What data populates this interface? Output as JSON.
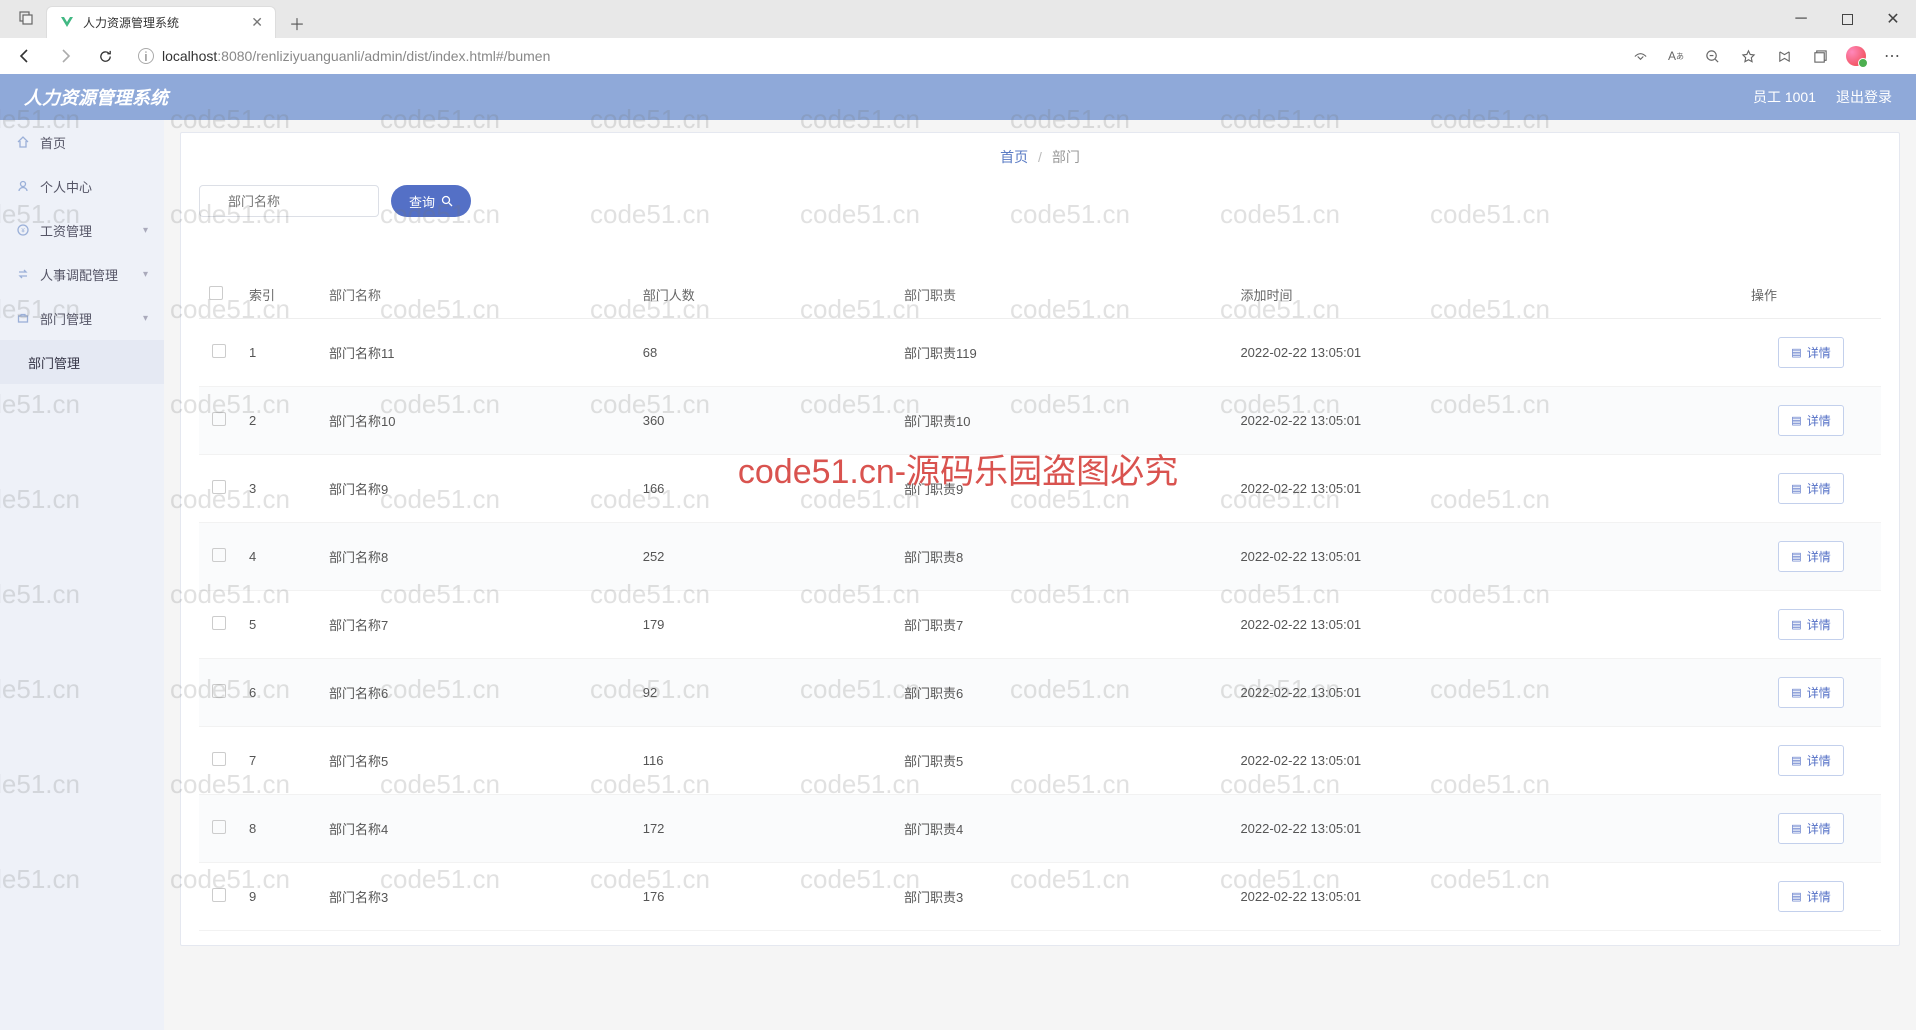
{
  "browser": {
    "tab_title": "人力资源管理系统",
    "url_host": "localhost",
    "url_port": ":8080",
    "url_path": "/renliziyuanguanli/admin/dist/index.html#/bumen"
  },
  "header": {
    "app_title": "人力资源管理系统",
    "user_label": "员工 1001",
    "logout_label": "退出登录"
  },
  "sidebar": {
    "items": [
      {
        "label": "首页",
        "icon": "home"
      },
      {
        "label": "个人中心",
        "icon": "user"
      },
      {
        "label": "工资管理",
        "icon": "money",
        "expandable": true
      },
      {
        "label": "人事调配管理",
        "icon": "swap",
        "expandable": true
      },
      {
        "label": "部门管理",
        "icon": "briefcase",
        "expandable": true
      }
    ],
    "active_sub": "部门管理"
  },
  "breadcrumb": {
    "home": "首页",
    "current": "部门"
  },
  "search": {
    "placeholder": "部门名称",
    "button": "查询"
  },
  "table": {
    "headers": {
      "index": "索引",
      "name": "部门名称",
      "count": "部门人数",
      "duty": "部门职责",
      "time": "添加时间",
      "op": "操作"
    },
    "detail_label": "详情",
    "rows": [
      {
        "index": "1",
        "name": "部门名称11",
        "count": "68",
        "duty": "部门职责119",
        "time": "2022-02-22 13:05:01"
      },
      {
        "index": "2",
        "name": "部门名称10",
        "count": "360",
        "duty": "部门职责10",
        "time": "2022-02-22 13:05:01"
      },
      {
        "index": "3",
        "name": "部门名称9",
        "count": "166",
        "duty": "部门职责9",
        "time": "2022-02-22 13:05:01"
      },
      {
        "index": "4",
        "name": "部门名称8",
        "count": "252",
        "duty": "部门职责8",
        "time": "2022-02-22 13:05:01"
      },
      {
        "index": "5",
        "name": "部门名称7",
        "count": "179",
        "duty": "部门职责7",
        "time": "2022-02-22 13:05:01"
      },
      {
        "index": "6",
        "name": "部门名称6",
        "count": "92",
        "duty": "部门职责6",
        "time": "2022-02-22 13:05:01"
      },
      {
        "index": "7",
        "name": "部门名称5",
        "count": "116",
        "duty": "部门职责5",
        "time": "2022-02-22 13:05:01"
      },
      {
        "index": "8",
        "name": "部门名称4",
        "count": "172",
        "duty": "部门职责4",
        "time": "2022-02-22 13:05:01"
      },
      {
        "index": "9",
        "name": "部门名称3",
        "count": "176",
        "duty": "部门职责3",
        "time": "2022-02-22 13:05:01"
      }
    ]
  },
  "watermark": {
    "text": "code51.cn",
    "center": "code51.cn-源码乐园盗图必究"
  }
}
